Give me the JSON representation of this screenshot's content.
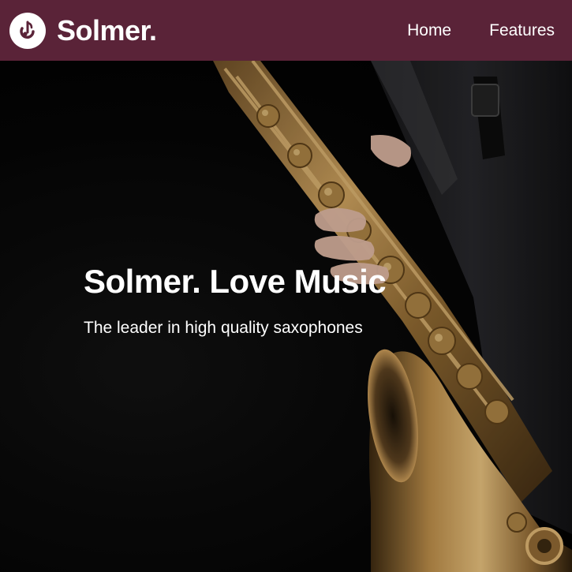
{
  "navbar": {
    "brand_name": "Solmer.",
    "logo_icon": "music-note-icon",
    "links": [
      {
        "label": "Home"
      },
      {
        "label": "Features"
      }
    ],
    "background_color": "#5a2338"
  },
  "hero": {
    "title": "Solmer. Love Music",
    "subtitle": "The leader in high quality saxophones",
    "image": "saxophone-player-photo"
  }
}
